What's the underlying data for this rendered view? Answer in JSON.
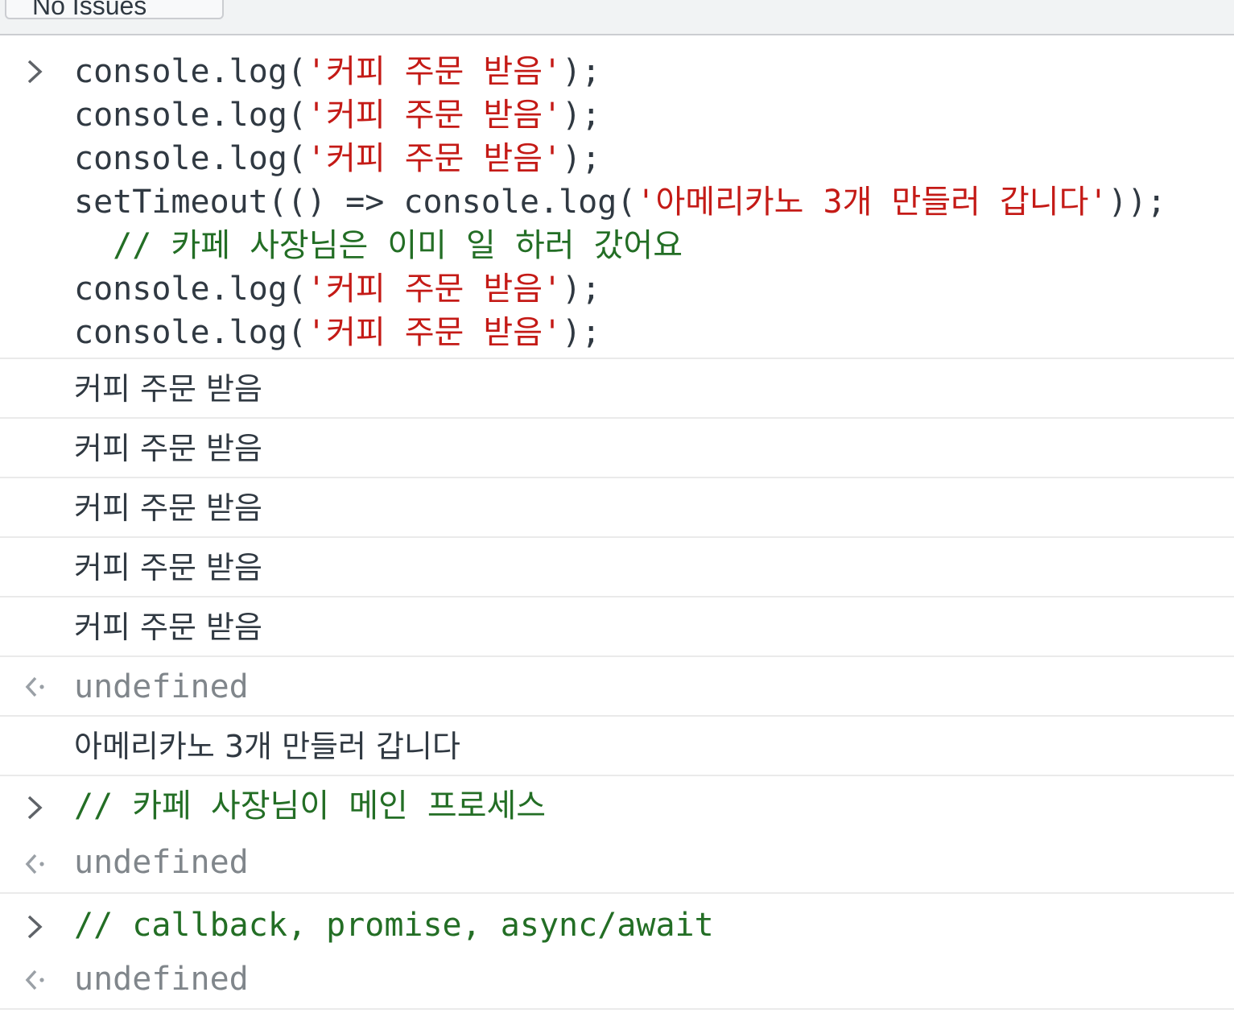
{
  "toolbar": {
    "issues_label": "No Issues"
  },
  "input_block": {
    "lines": [
      {
        "pre": "console.log(",
        "str": "'커피 주문 받음'",
        "post": ");"
      },
      {
        "pre": "console.log(",
        "str": "'커피 주문 받음'",
        "post": ");"
      },
      {
        "pre": "console.log(",
        "str": "'커피 주문 받음'",
        "post": ");"
      },
      {
        "pre": "setTimeout(() => console.log(",
        "str": "'아메리카노 3개 만들러 갑니다'",
        "post": "));"
      },
      {
        "comment": "  // 카페 사장님은 이미 일 하러 갔어요"
      },
      {
        "pre": "console.log(",
        "str": "'커피 주문 받음'",
        "post": ");"
      },
      {
        "pre": "console.log(",
        "str": "'커피 주문 받음'",
        "post": ");"
      }
    ]
  },
  "logs": [
    "커피 주문 받음",
    "커피 주문 받음",
    "커피 주문 받음",
    "커피 주문 받음",
    "커피 주문 받음"
  ],
  "result_1": "undefined",
  "timeout_log": "아메리카노 3개 만들러 갑니다",
  "input_2": "// 카페 사장님이 메인 프로세스",
  "result_2": "undefined",
  "input_3": "// callback, promise, async/await",
  "result_3": "undefined",
  "colors": {
    "string": "#c41a16",
    "comment": "#236e25",
    "undefined": "#80868b"
  }
}
